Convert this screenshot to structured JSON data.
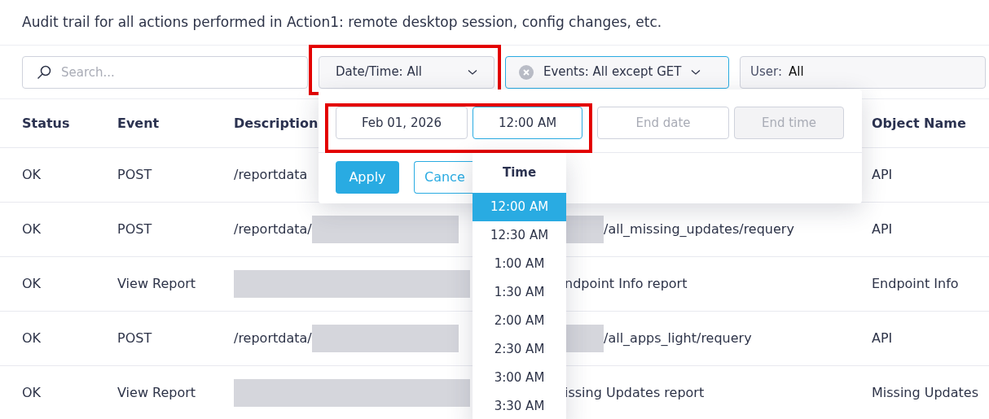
{
  "title": "Audit trail for all actions performed in Action1: remote desktop session, config changes, etc.",
  "toolbar": {
    "search": {
      "placeholder": "Search..."
    },
    "filters": [
      {
        "kind": "dropdown",
        "label": "Date/Time: All",
        "active": false,
        "highlighted": true
      },
      {
        "kind": "clearable",
        "label": "Events: All except GET",
        "active": true,
        "highlighted": false
      },
      {
        "kind": "user",
        "label": "User:",
        "value": "All",
        "active": false,
        "highlighted": false
      }
    ]
  },
  "table": {
    "columns": [
      "Status",
      "Event",
      "Description",
      "Object Name"
    ],
    "rows": [
      {
        "status": "OK",
        "event": "POST",
        "prefix": "/reportdata",
        "prefix_redacted": false,
        "suffix": "",
        "suffix_redacted": false,
        "object": "API"
      },
      {
        "status": "OK",
        "event": "POST",
        "prefix": "/reportdata/",
        "prefix_redacted": true,
        "suffix": "/all_missing_updates/requery",
        "suffix_redacted": true,
        "object": "API"
      },
      {
        "status": "OK",
        "event": "View Report",
        "prefix": "",
        "prefix_redacted": true,
        "suffix": "ndpoint Info report",
        "suffix_redacted": false,
        "object": "Endpoint Info"
      },
      {
        "status": "OK",
        "event": "POST",
        "prefix": "/reportdata/",
        "prefix_redacted": true,
        "suffix": "/all_apps_light/requery",
        "suffix_redacted": true,
        "object": "API"
      },
      {
        "status": "OK",
        "event": "View Report",
        "prefix": "",
        "prefix_redacted": true,
        "suffix": "issing Updates report",
        "suffix_redacted": false,
        "object": "Missing Updates"
      }
    ]
  },
  "date_popover": {
    "fields": [
      {
        "kind": "date",
        "value": "Feb 01, 2026",
        "focused": false,
        "disabled": false,
        "highlighted": true
      },
      {
        "kind": "time",
        "value": "12:00 AM",
        "focused": true,
        "disabled": false,
        "highlighted": true
      },
      {
        "kind": "date",
        "placeholder": "End date",
        "focused": false,
        "disabled": false,
        "highlighted": false
      },
      {
        "kind": "time",
        "placeholder": "End time",
        "focused": false,
        "disabled": true,
        "highlighted": false
      }
    ],
    "buttons": [
      {
        "kind": "primary",
        "label": "Apply"
      },
      {
        "kind": "secondary",
        "label": "Cance"
      }
    ]
  },
  "time_dropdown": {
    "header": "Time",
    "options": [
      {
        "label": "12:00 AM",
        "selected": true
      },
      {
        "label": "12:30 AM",
        "selected": false
      },
      {
        "label": "1:00 AM",
        "selected": false
      },
      {
        "label": "1:30 AM",
        "selected": false
      },
      {
        "label": "2:00 AM",
        "selected": false
      },
      {
        "label": "2:30 AM",
        "selected": false
      },
      {
        "label": "3:00 AM",
        "selected": false
      },
      {
        "label": "3:30 AM",
        "selected": false
      }
    ]
  }
}
